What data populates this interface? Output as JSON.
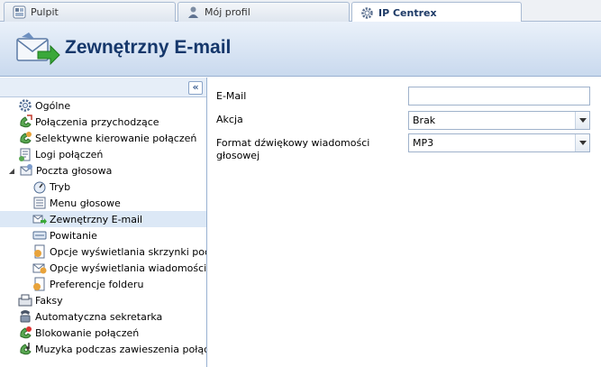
{
  "tabs": [
    {
      "label": "Pulpit",
      "icon": "dashboard-icon",
      "active": false
    },
    {
      "label": "Mój profil",
      "icon": "user-icon",
      "active": false
    },
    {
      "label": "IP Centrex",
      "icon": "gear-icon",
      "active": true
    }
  ],
  "header": {
    "title": "Zewnętrzny E-mail",
    "icon": "email-forward-icon"
  },
  "sidebar": {
    "collapse_label": "«",
    "items": [
      {
        "label": "Ogólne",
        "icon": "gear-icon"
      },
      {
        "label": "Połączenia przychodzące",
        "icon": "incoming-call-icon"
      },
      {
        "label": "Selektywne kierowanie połączeń",
        "icon": "routing-icon"
      },
      {
        "label": "Logi połączeń",
        "icon": "call-log-icon"
      },
      {
        "label": "Poczta głosowa",
        "icon": "voicemail-icon"
      },
      {
        "label": "Tryb",
        "icon": "mode-icon"
      },
      {
        "label": "Menu głosowe",
        "icon": "menu-icon"
      },
      {
        "label": "Zewnętrzny E-mail",
        "icon": "email-icon"
      },
      {
        "label": "Powitanie",
        "icon": "greeting-icon"
      },
      {
        "label": "Opcje wyświetlania skrzynki poczto",
        "icon": "mailbox-display-icon"
      },
      {
        "label": "Opcje wyświetlania wiadomości",
        "icon": "message-display-icon"
      },
      {
        "label": "Preferencje folderu",
        "icon": "folder-icon"
      },
      {
        "label": "Faksy",
        "icon": "fax-icon"
      },
      {
        "label": "Automatyczna sekretarka",
        "icon": "answering-machine-icon"
      },
      {
        "label": "Blokowanie połączeń",
        "icon": "block-call-icon"
      },
      {
        "label": "Muzyka podczas zawieszenia połączer",
        "icon": "music-icon"
      }
    ]
  },
  "form": {
    "email": {
      "label": "E-Mail",
      "value": ""
    },
    "action": {
      "label": "Akcja",
      "value": "Brak"
    },
    "format": {
      "label": "Format dźwiękowy wiadomości głosowej",
      "value": "MP3"
    }
  },
  "colors": {
    "accent": "#15376b",
    "header_bg": "#c9d9ee",
    "selected_bg": "#dce8f6"
  }
}
